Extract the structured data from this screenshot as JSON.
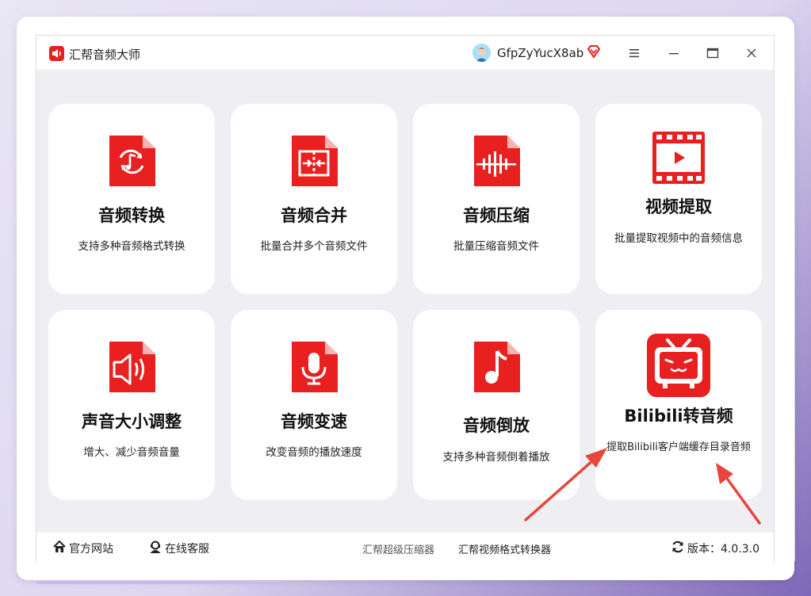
{
  "app": {
    "title": "汇帮音频大师"
  },
  "user": {
    "name": "GfpZyYucX8ab"
  },
  "window_buttons": {
    "menu": "≡",
    "minimize": "—",
    "maximize": "▭",
    "close": "×"
  },
  "tools": [
    {
      "title": "音频转换",
      "desc": "支持多种音频格式转换",
      "icon": "audio-convert-icon"
    },
    {
      "title": "音频合并",
      "desc": "批量合并多个音频文件",
      "icon": "audio-merge-icon"
    },
    {
      "title": "音频压缩",
      "desc": "批量压缩音频文件",
      "icon": "audio-compress-icon"
    },
    {
      "title": "视频提取",
      "desc": "批量提取视频中的音频信息",
      "icon": "video-film-icon"
    },
    {
      "title": "声音大小调整",
      "desc": "增大、减少音频音量",
      "icon": "volume-icon"
    },
    {
      "title": "音频变速",
      "desc": "改变音频的播放速度",
      "icon": "microphone-icon"
    },
    {
      "title": "音频倒放",
      "desc": "支持多种音频倒着播放",
      "icon": "music-note-icon"
    },
    {
      "title": "Bilibili转音频",
      "desc": "提取Bilibili客户端缓存目录音频",
      "icon": "bilibili-tv-icon"
    }
  ],
  "footer": {
    "website": "官方网站",
    "support": "在线客服",
    "link1": "汇帮超级压缩器",
    "link2": "汇帮视频格式转换器",
    "version_label": "版本：",
    "version": "4.0.3.0"
  },
  "colors": {
    "accent_red": "#e8201f",
    "card_bg": "#ffffff",
    "content_bg": "#eeeef3",
    "arrow": "#e8453c"
  }
}
